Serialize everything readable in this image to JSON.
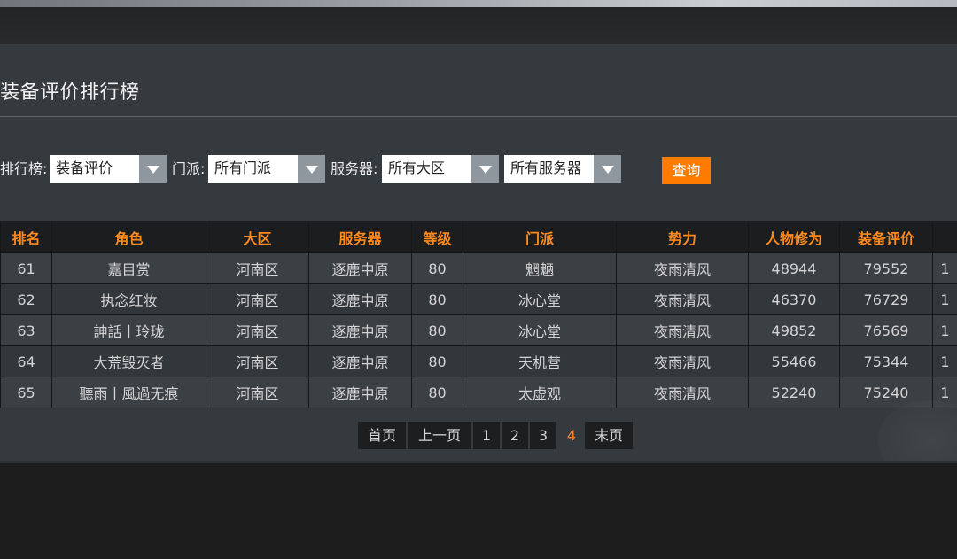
{
  "page": {
    "title": "装备评价排行榜"
  },
  "filters": {
    "rank_label": "排行榜:",
    "rank_value": "装备评价",
    "school_label": "门派:",
    "school_value": "所有门派",
    "server_label": "服务器:",
    "region_value": "所有大区",
    "server_value": "所有服务器",
    "query_label": "查询"
  },
  "table": {
    "headers": [
      "排名",
      "角色",
      "大区",
      "服务器",
      "等级",
      "门派",
      "势力",
      "人物修为",
      "装备评价",
      ""
    ],
    "rows": [
      [
        "61",
        "嘉目赏",
        "河南区",
        "逐鹿中原",
        "80",
        "魍魉",
        "夜雨清风",
        "48944",
        "79552",
        "1"
      ],
      [
        "62",
        "执念红妆",
        "河南区",
        "逐鹿中原",
        "80",
        "冰心堂",
        "夜雨清风",
        "46370",
        "76729",
        "1"
      ],
      [
        "63",
        "訷話丨玲珑",
        "河南区",
        "逐鹿中原",
        "80",
        "冰心堂",
        "夜雨清风",
        "49852",
        "76569",
        "1"
      ],
      [
        "64",
        "大荒毁灭者",
        "河南区",
        "逐鹿中原",
        "80",
        "天机营",
        "夜雨清风",
        "55466",
        "75344",
        "1"
      ],
      [
        "65",
        "聽雨丨風過无痕",
        "河南区",
        "逐鹿中原",
        "80",
        "太虚观",
        "夜雨清风",
        "52240",
        "75240",
        "1"
      ]
    ]
  },
  "pagination": {
    "first": "首页",
    "prev": "上一页",
    "pages": [
      "1",
      "2",
      "3",
      "4"
    ],
    "current": "4",
    "last": "末页"
  },
  "colors": {
    "accent": "#ff7b00",
    "header_text": "#ff8a1c",
    "panel_bg": "#353a3f"
  }
}
